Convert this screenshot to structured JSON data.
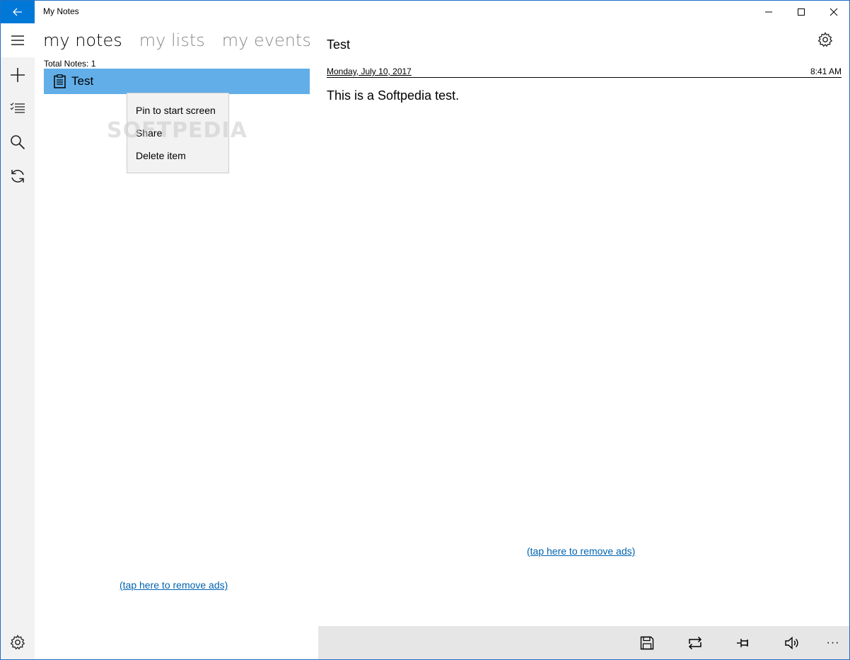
{
  "window": {
    "title": "My Notes"
  },
  "tabs": [
    {
      "label": "my notes",
      "active": true
    },
    {
      "label": "my lists",
      "active": false
    },
    {
      "label": "my events",
      "active": false
    }
  ],
  "notes_list": {
    "total_label": "Total Notes: 1",
    "items": [
      {
        "label": "Test",
        "icon": "note-icon",
        "selected": true
      }
    ]
  },
  "context_menu": {
    "items": [
      {
        "label": "Pin to start screen"
      },
      {
        "label": "Share"
      },
      {
        "label": "Delete item"
      }
    ]
  },
  "watermark": "SOFTPEDIA",
  "ads": {
    "left_link": "(tap here to remove ads)",
    "right_link": "(tap here to remove ads)"
  },
  "detail": {
    "title": "Test",
    "date": "Monday, July 10, 2017",
    "time": "8:41 AM",
    "body": "This is a Softpedia test."
  },
  "rail": {
    "icons": [
      "hamburger-icon",
      "add-icon",
      "checklist-icon",
      "search-icon",
      "sync-icon",
      "settings-icon"
    ]
  },
  "cmdbar": {
    "icons": [
      "save-icon",
      "repeat-icon",
      "pin-icon",
      "volume-icon",
      "more-icon"
    ],
    "more_label": "···"
  },
  "colors": {
    "accent": "#0078d7",
    "selected_item": "#62aee8",
    "link": "#0063b1",
    "rail_bg": "#f2f2f2",
    "cmdbar_bg": "#e6e6e6"
  }
}
